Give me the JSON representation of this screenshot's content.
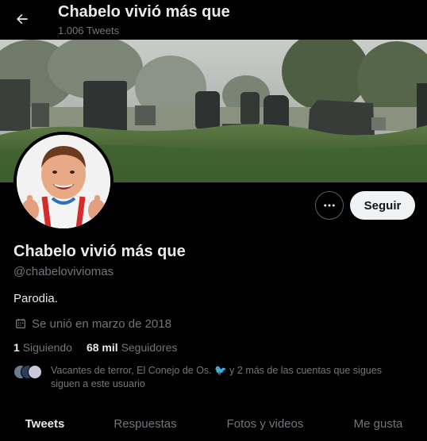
{
  "header": {
    "title": "Chabelo vivió más que",
    "tweet_count": "1.006 Tweets"
  },
  "profile": {
    "display_name": "Chabelo vivió más que",
    "handle": "@chabeloviviomas",
    "bio": "Parodia.",
    "joined": "Se unió en marzo de 2018",
    "following_count": "1",
    "following_label": "Siguiendo",
    "followers_count": "68 mil",
    "followers_label": "Seguidores",
    "known_followers_line1": "Vacantes de terror, El Conejo de Os. 🐦 y 2 más de las cuentas que sigues",
    "known_followers_line2": "siguen a este usuario"
  },
  "actions": {
    "follow_label": "Seguir"
  },
  "tabs": [
    {
      "label": "Tweets",
      "active": true
    },
    {
      "label": "Respuestas",
      "active": false
    },
    {
      "label": "Fotos y videos",
      "active": false
    },
    {
      "label": "Me gusta",
      "active": false
    }
  ],
  "colors": {
    "background": "#000000",
    "text_primary": "#e7e9ea",
    "text_secondary": "#71767b",
    "follow_button_bg": "#eff3f4",
    "border": "#536471"
  }
}
